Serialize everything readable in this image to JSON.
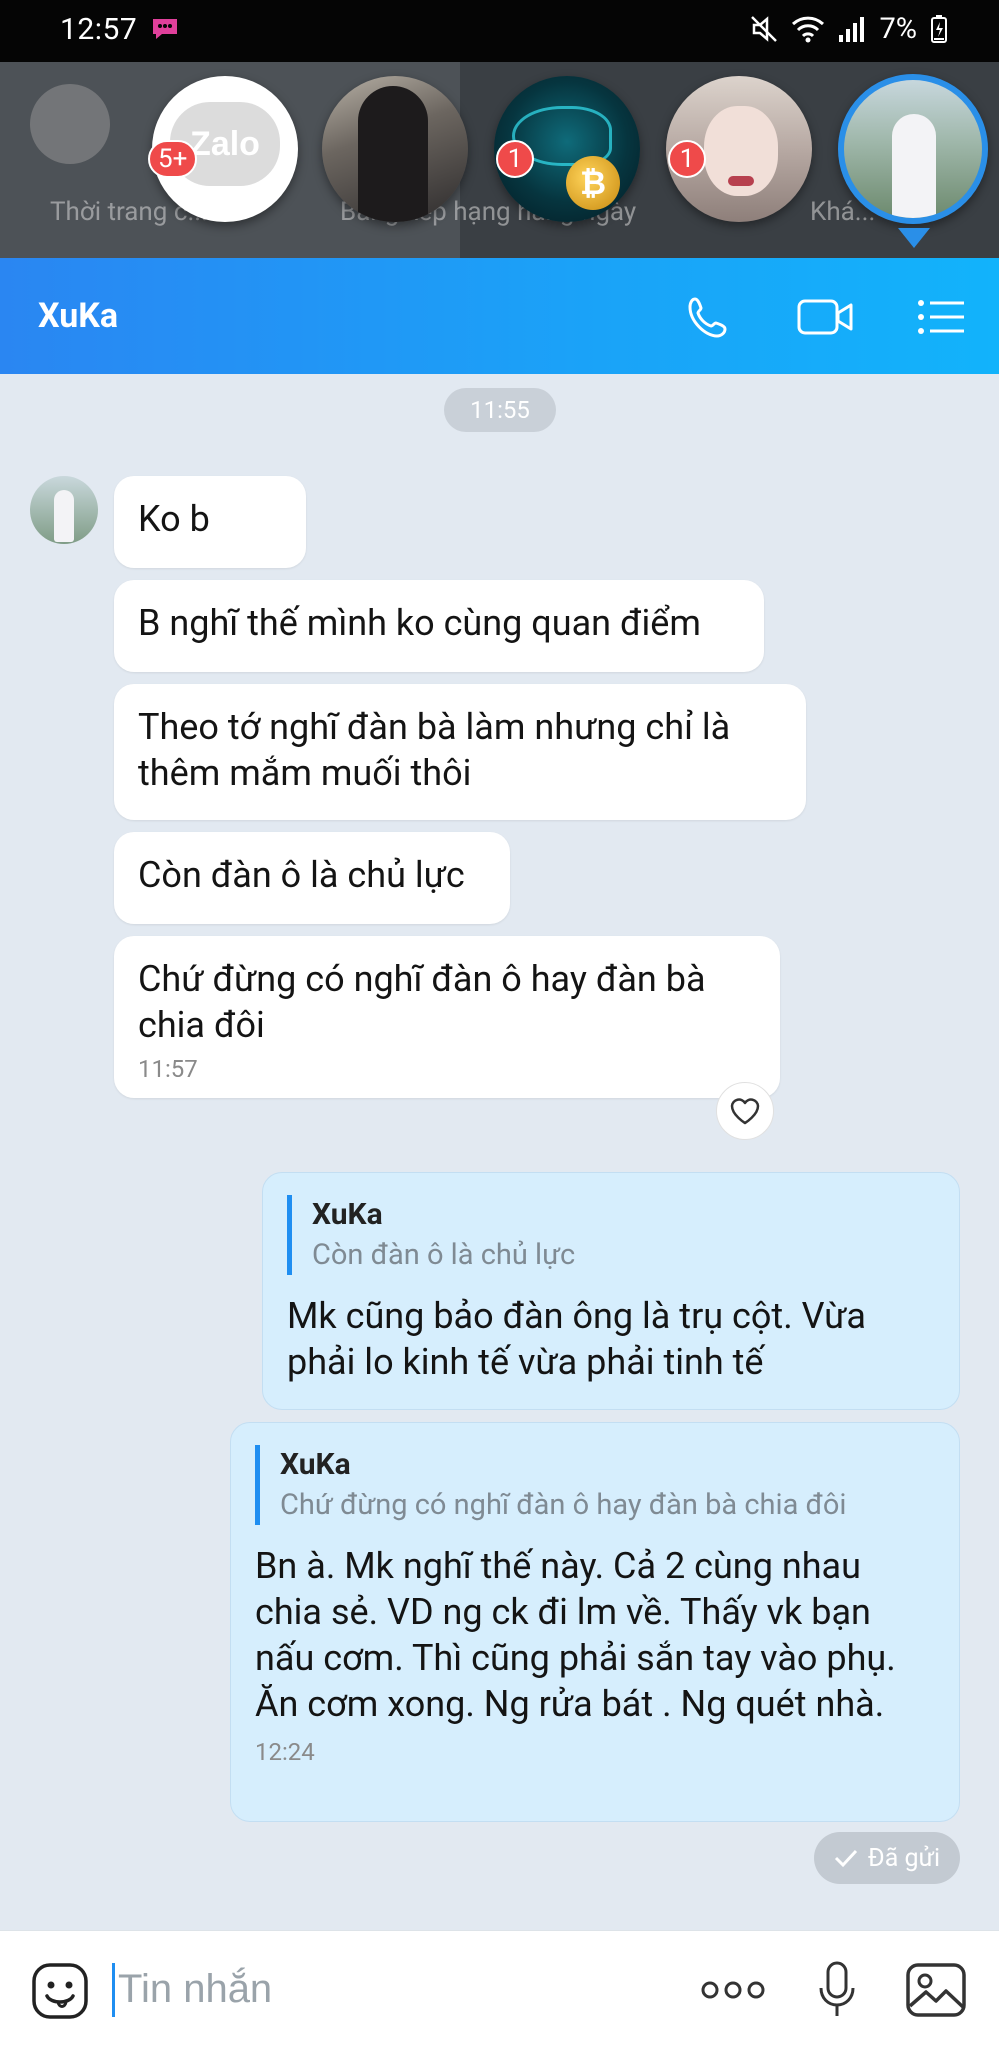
{
  "status_bar": {
    "time": "12:57",
    "battery": "7%"
  },
  "chat_heads": {
    "badges": [
      "5+",
      "1",
      "1"
    ],
    "zalo_label": "Zalo",
    "background_hints": [
      "Thời trang c...",
      "Bảng xếp hạng hàng ngày",
      "Khá..."
    ]
  },
  "header": {
    "title": "XuKa"
  },
  "messages": {
    "time_divider": "11:55",
    "incoming": [
      {
        "text": "Ko b"
      },
      {
        "text": "B nghĩ thế mình ko cùng quan điểm"
      },
      {
        "text": "Theo tớ nghĩ đàn bà làm nhưng chỉ là thêm mắm muối thôi"
      },
      {
        "text": "Còn đàn ô là chủ lực"
      },
      {
        "text": "Chứ đừng có nghĩ đàn ô hay đàn bà chia đôi",
        "time": "11:57"
      }
    ],
    "outgoing": [
      {
        "quote_name": "XuKa",
        "quote_text": "Còn đàn ô là chủ lực",
        "text": " Mk cũng bảo đàn ông là  trụ cột. Vừa phải lo kinh tế vừa phải tinh tế"
      },
      {
        "quote_name": "XuKa",
        "quote_text": "Chứ đừng có nghĩ đàn ô hay đàn bà chia đôi",
        "text": " Bn à. Mk nghĩ thế này.  Cả 2 cùng nhau chia sẻ.  VD   ng ck đi lm về. Thấy vk bạn nấu cơm. Thì cũng phải sắn tay vào phụ.  Ăn cơm xong. Ng rửa bát . Ng quét nhà.",
        "time": "12:24"
      }
    ],
    "sent_status": "Đã gửi"
  },
  "input": {
    "placeholder": "Tin nhắn",
    "value": ""
  },
  "colors": {
    "header_start": "#2a86f2",
    "header_end": "#12b3fb",
    "accent": "#1f8ef1",
    "outgoing_bubble": "#d6eefd",
    "badge": "#ef4a4a"
  }
}
